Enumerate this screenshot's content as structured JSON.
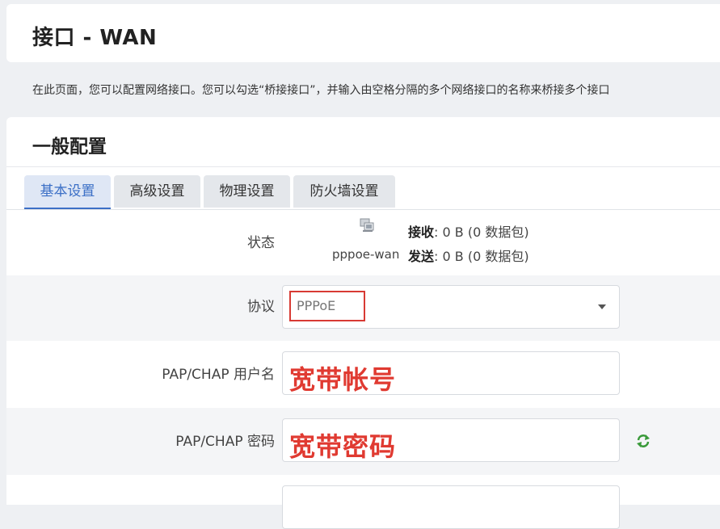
{
  "page": {
    "title": "接口 - WAN",
    "description": "在此页面，您可以配置网络接口。您可以勾选“桥接接口”，并输入由空格分隔的多个网络接口的名称来桥接多个接口"
  },
  "section": {
    "title": "一般配置",
    "tabs": [
      {
        "label": "基本设置",
        "active": true
      },
      {
        "label": "高级设置",
        "active": false
      },
      {
        "label": "物理设置",
        "active": false
      },
      {
        "label": "防火墙设置",
        "active": false
      }
    ]
  },
  "form": {
    "status": {
      "label": "状态",
      "interface": "pppoe-wan",
      "rx_label": "接收",
      "rx_value": ": 0 B (0 数据包)",
      "tx_label": "发送",
      "tx_value": ": 0 B (0 数据包)",
      "icon": "network-port-icon"
    },
    "protocol": {
      "label": "协议",
      "value": "PPPoE"
    },
    "username": {
      "label": "PAP/CHAP 用户名",
      "value": "宽带帐号"
    },
    "password": {
      "label": "PAP/CHAP 密码",
      "value": "宽带密码",
      "icon": "refresh-icon"
    }
  },
  "colors": {
    "accent": "#3b6fc6",
    "annotation_red": "#e03a31"
  }
}
